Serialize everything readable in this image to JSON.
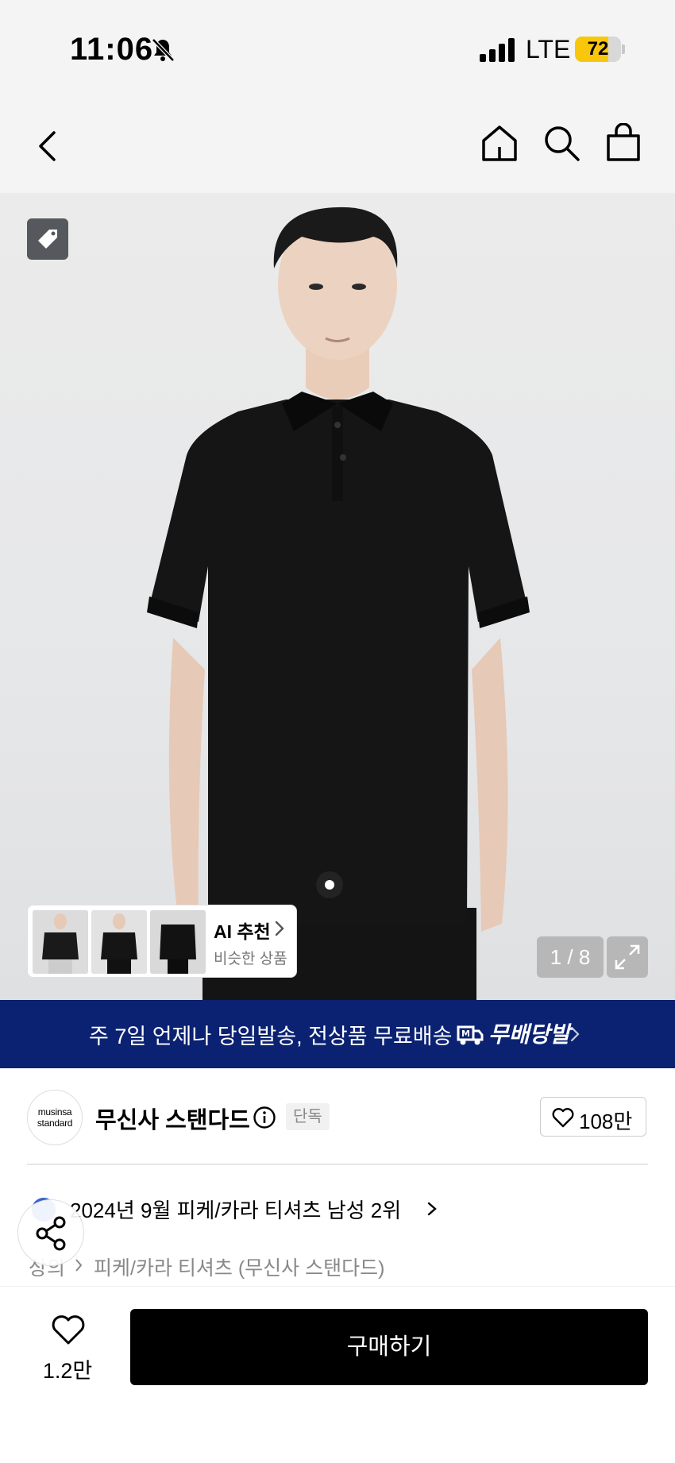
{
  "status_bar": {
    "time": "11:06",
    "network": "LTE",
    "battery_level": "72",
    "battery_fraction": 0.72,
    "battery_color": "#f8c70c"
  },
  "nav": {
    "icons": [
      "back-icon",
      "home-icon",
      "search-icon",
      "shopping-bag-icon"
    ]
  },
  "gallery": {
    "counter": "1 / 8",
    "ai_recommend": {
      "title": "AI 추천",
      "subtitle": "비슷한 상품"
    }
  },
  "promo": {
    "text": "주 7일 언제나 당일발송, 전상품 무료배송",
    "brand": "무배당발",
    "background_color": "#0b2272"
  },
  "brand": {
    "logo_line1": "musinsa",
    "logo_line2": "standard",
    "name": "무신사 스탠다드",
    "badge": "단독",
    "likes": "108만"
  },
  "ranking": {
    "text": "2024년 9월 피케/카라 티셔츠 남성 2위"
  },
  "breadcrumb": {
    "category": "상의",
    "subcategory": "피케/카라 티셔츠 (무신사 스탠다드)"
  },
  "bottom_bar": {
    "wish_count": "1.2만",
    "buy_label": "구매하기"
  }
}
